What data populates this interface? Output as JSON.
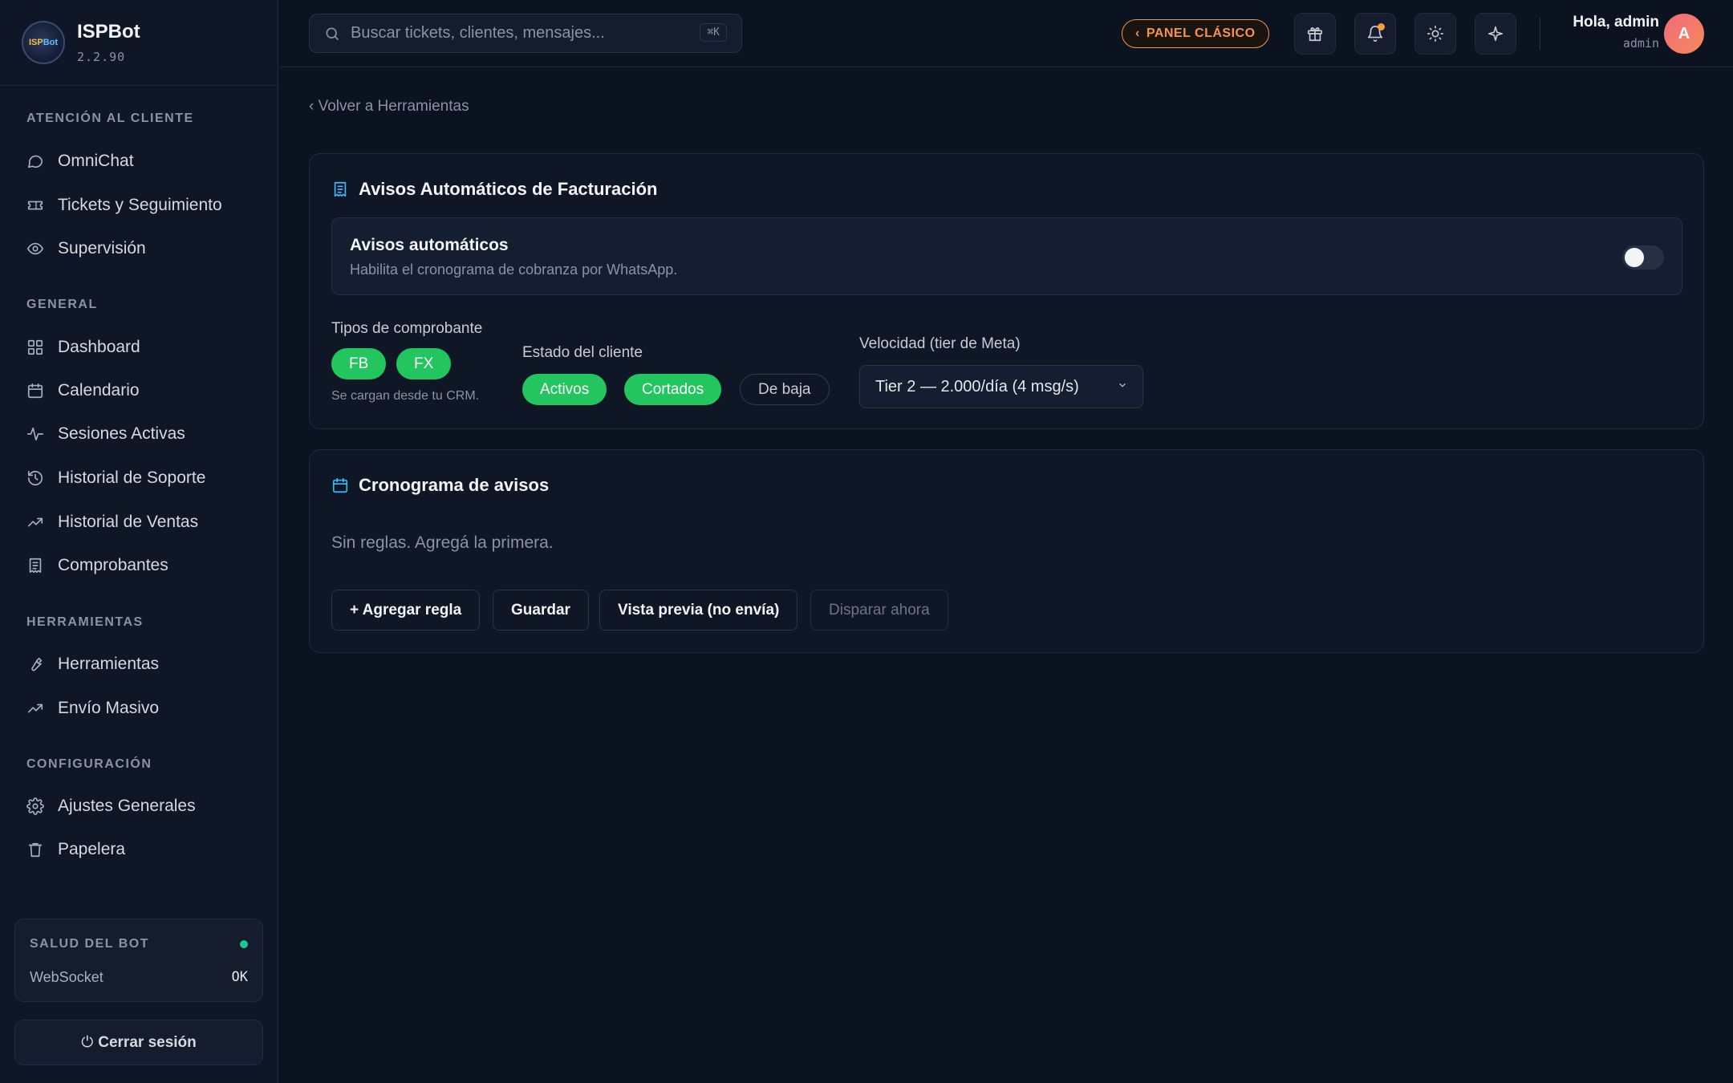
{
  "app": {
    "name": "ISPBot",
    "version": "2.2.90",
    "logo_text_a": "ISP",
    "logo_text_b": "Bot"
  },
  "sidebar": {
    "sections": [
      {
        "title": "ATENCIÓN AL CLIENTE",
        "items": [
          "OmniChat",
          "Tickets y Seguimiento",
          "Supervisión"
        ]
      },
      {
        "title": "GENERAL",
        "items": [
          "Dashboard",
          "Calendario",
          "Sesiones Activas",
          "Historial de Soporte",
          "Historial de Ventas",
          "Comprobantes"
        ]
      },
      {
        "title": "HERRAMIENTAS",
        "items": [
          "Herramientas",
          "Envío Masivo"
        ]
      },
      {
        "title": "CONFIGURACIÓN",
        "items": [
          "Ajustes Generales",
          "Papelera"
        ]
      }
    ],
    "health": {
      "title": "SALUD DEL BOT",
      "label": "WebSocket",
      "value": "OK",
      "status_color": "#22c58b"
    },
    "logout": {
      "icon": "⏻",
      "label": "Cerrar sesión"
    }
  },
  "topbar": {
    "search_placeholder": "Buscar tickets, clientes, mensajes...",
    "search_shortcut": "⌘K",
    "classic_panel": "PANEL CLÁSICO",
    "greeting": "Hola, admin",
    "role": "admin",
    "avatar_initial": "A"
  },
  "main": {
    "back_link": "‹ Volver a Herramientas",
    "billing_card": {
      "title": "Avisos Automáticos de Facturación",
      "toggle": {
        "title": "Avisos automáticos",
        "description": "Habilita el cronograma de cobranza por WhatsApp.",
        "enabled": false
      },
      "receipt_types": {
        "label": "Tipos de comprobante",
        "options": [
          "FB",
          "FX"
        ],
        "hint": "Se cargan desde tu CRM."
      },
      "client_status": {
        "label": "Estado del cliente",
        "options": [
          "Activos",
          "Cortados",
          "De baja"
        ],
        "selected": [
          "Activos",
          "Cortados"
        ]
      },
      "speed": {
        "label": "Velocidad (tier de Meta)",
        "value": "Tier 2 — 2.000/día (4 msg/s)"
      }
    },
    "schedule_card": {
      "title": "Cronograma de avisos",
      "empty_text": "Sin reglas. Agregá la primera.",
      "buttons": {
        "add": "+ Agregar regla",
        "save": "Guardar",
        "preview": "Vista previa (no envía)",
        "trigger": "Disparar ahora"
      }
    }
  },
  "colors": {
    "accent_green": "#22c55e",
    "accent_orange": "#f5934b",
    "accent_cyan": "#38bdf8",
    "background": "#0b1220"
  }
}
